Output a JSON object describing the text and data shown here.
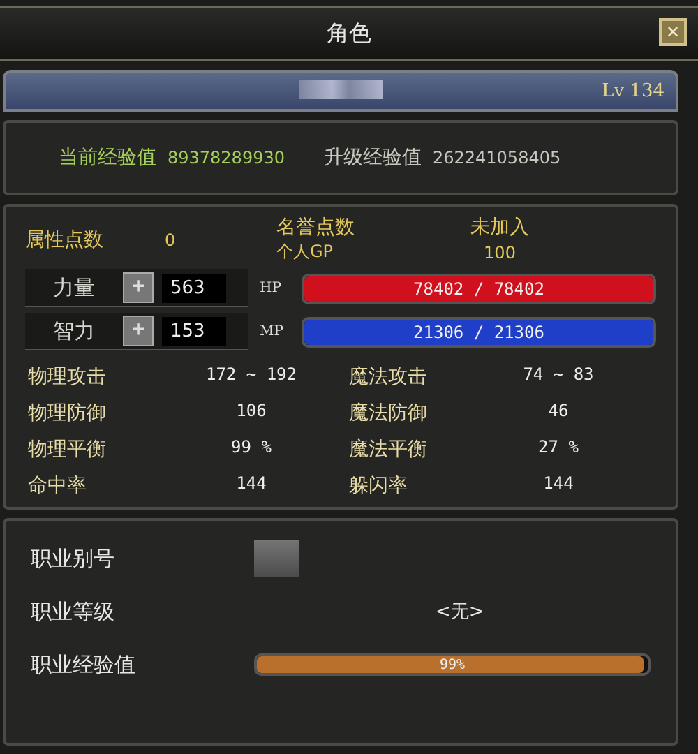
{
  "window": {
    "title": "角色",
    "close": "✕"
  },
  "name_bar": {
    "level_label": "Lv",
    "level": "134"
  },
  "exp": {
    "current_label": "当前经验值",
    "current": "89378289930",
    "next_label": "升级经验值",
    "next": "262241058405"
  },
  "points": {
    "label": "属性点数",
    "value": "0",
    "honor_label": "名誉点数",
    "honor_value": "未加入",
    "gp_label": "个人GP",
    "gp_value": "100"
  },
  "attributes": [
    {
      "name": "力量",
      "plus": "+",
      "value": "563",
      "bar_label": "HP",
      "bar_text": "78402 / 78402",
      "level": 1,
      "color": "#d0101c"
    },
    {
      "name": "智力",
      "plus": "+",
      "value": "153",
      "bar_label": "MP",
      "bar_text": "21306 / 21306",
      "level": 1,
      "color": "#1f3fc8"
    }
  ],
  "stats": [
    {
      "label": "物理攻击",
      "value": "172 ~ 192"
    },
    {
      "label": "魔法攻击",
      "value": "74 ~ 83"
    },
    {
      "label": "物理防御",
      "value": "106"
    },
    {
      "label": "魔法防御",
      "value": "46"
    },
    {
      "label": "物理平衡",
      "value": "99 %"
    },
    {
      "label": "魔法平衡",
      "value": "27 %"
    },
    {
      "label": "命中率",
      "value": "144"
    },
    {
      "label": "躲闪率",
      "value": "144"
    }
  ],
  "job": {
    "alias_label": "职业别号",
    "level_label": "职业等级",
    "level_value": "<无>",
    "exp_label": "职业经验值",
    "exp_text": "99%",
    "level": 0.99
  }
}
